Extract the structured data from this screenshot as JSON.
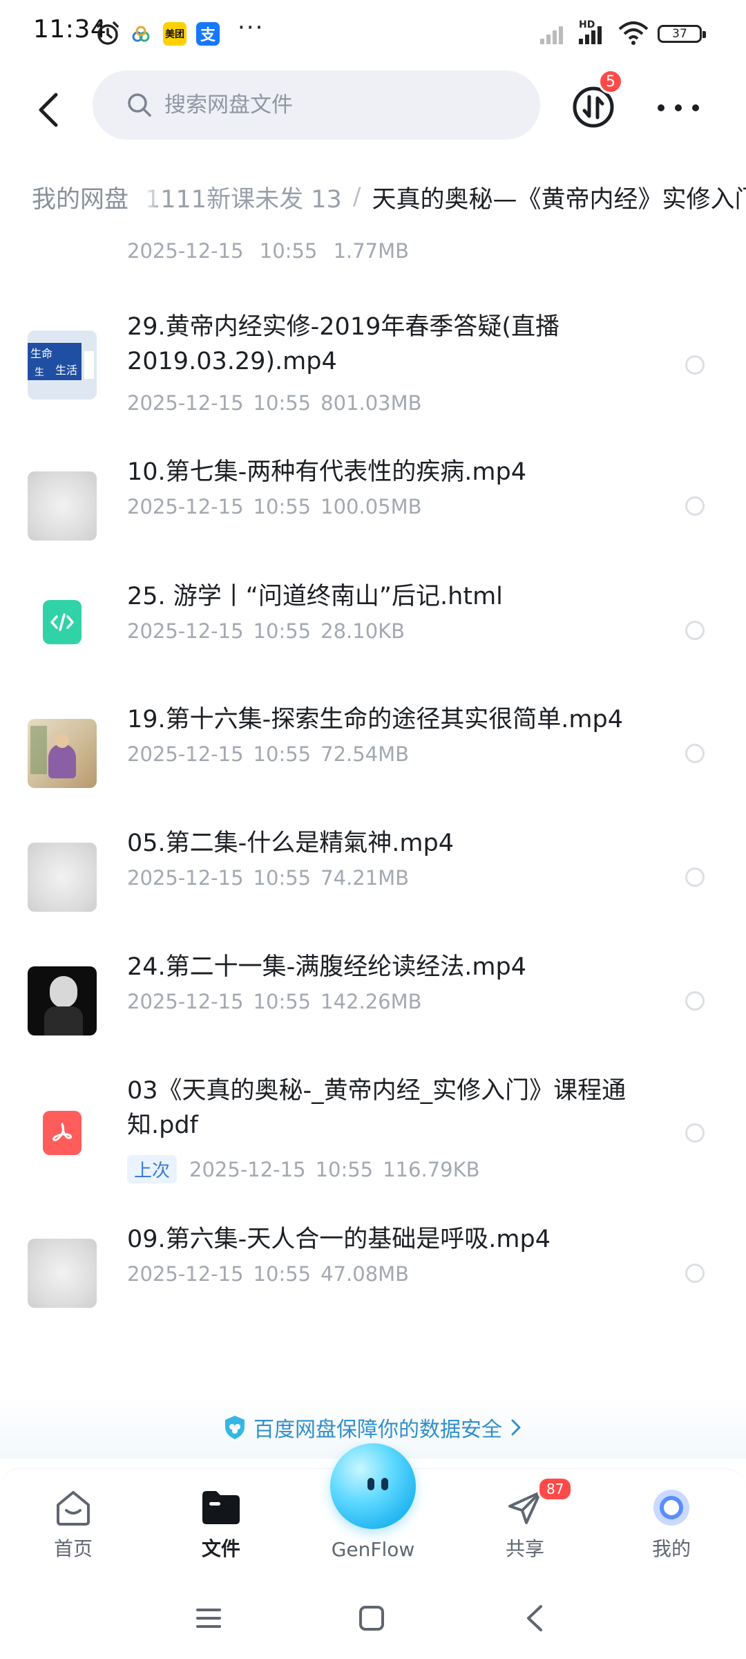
{
  "status_bar": {
    "time": "11:34",
    "app_badges": [
      "美团",
      "支"
    ],
    "more": "···",
    "net_label": "HD",
    "battery": "37"
  },
  "header": {
    "search_placeholder": "搜索网盘文件",
    "transfer_badge": "5"
  },
  "breadcrumb": {
    "root": "我的网盘",
    "items": [
      "1111新课未发 13",
      "天真的奥秘—《黄帝内经》实修入门"
    ]
  },
  "partial_row": {
    "date": "2025-12-15",
    "time": "10:55",
    "size": "1.77MB"
  },
  "files": [
    {
      "name": "29.黄帝内经实修-2019年春季答疑(直播2019.03.29).mp4",
      "date": "2025-12-15",
      "time": "10:55",
      "size": "801.03MB",
      "thumb": "video-thumb-blue",
      "thumb_text": [
        "生命",
        "生活",
        "生"
      ]
    },
    {
      "name": "10.第七集-两种有代表性的疾病.mp4",
      "date": "2025-12-15",
      "time": "10:55",
      "size": "100.05MB",
      "thumb": "video-thumb-gray"
    },
    {
      "name": "25. 游学丨“问道终南山”后记.html",
      "date": "2025-12-15",
      "time": "10:55",
      "size": "28.10KB",
      "thumb": "code-icon",
      "icon_color": "#2fd3a7"
    },
    {
      "name": "19.第十六集-探索生命的途径其实很简单.mp4",
      "date": "2025-12-15",
      "time": "10:55",
      "size": "72.54MB",
      "thumb": "video-thumb-painting"
    },
    {
      "name": "05.第二集-什么是精氣神.mp4",
      "date": "2025-12-15",
      "time": "10:55",
      "size": "74.21MB",
      "thumb": "video-thumb-gray"
    },
    {
      "name": "24.第二十一集-满腹经纶读经法.mp4",
      "date": "2025-12-15",
      "time": "10:55",
      "size": "142.26MB",
      "thumb": "video-thumb-dark"
    },
    {
      "name": "03《天真的奥秘-_黄帝内经_实修入门》课程通知.pdf",
      "tag": "上次",
      "date": "2025-12-15",
      "time": "10:55",
      "size": "116.79KB",
      "thumb": "pdf-icon",
      "icon_color": "#ff5c5c"
    },
    {
      "name": "09.第六集-天人合一的基础是呼吸.mp4",
      "date": "2025-12-15",
      "time": "10:55",
      "size": "47.08MB",
      "thumb": "video-thumb-gray"
    }
  ],
  "security_banner": "百度网盘保障你的数据安全",
  "bottom_nav": {
    "home": "首页",
    "files": "文件",
    "genflow": "GenFlow",
    "share": "共享",
    "share_badge": "87",
    "mine": "我的"
  },
  "colors": {
    "accent": "#2f8fcc",
    "badge": "#ff4a4a",
    "html_icon": "#2fd3a7",
    "pdf_icon": "#ff5c5c"
  }
}
